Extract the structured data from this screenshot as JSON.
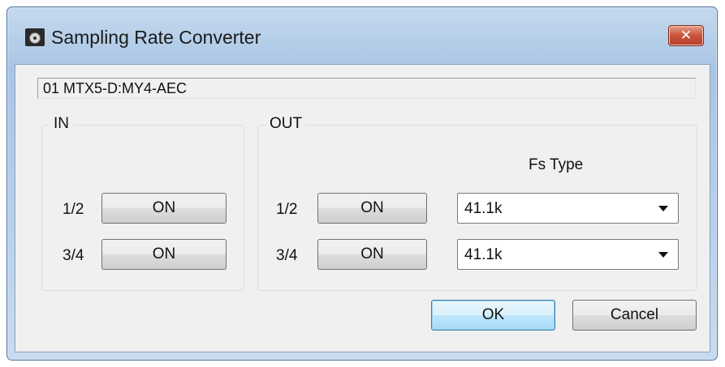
{
  "window": {
    "title": "Sampling Rate Converter",
    "close_label": "✕"
  },
  "device": {
    "name": "01 MTX5-D:MY4-AEC"
  },
  "in_group": {
    "label": "IN",
    "rows": [
      {
        "channel": "1/2",
        "button": "ON"
      },
      {
        "channel": "3/4",
        "button": "ON"
      }
    ]
  },
  "out_group": {
    "label": "OUT",
    "fs_type_header": "Fs Type",
    "rows": [
      {
        "channel": "1/2",
        "button": "ON",
        "fs_type": "41.1k"
      },
      {
        "channel": "3/4",
        "button": "ON",
        "fs_type": "41.1k"
      }
    ]
  },
  "footer": {
    "ok_label": "OK",
    "cancel_label": "Cancel"
  }
}
